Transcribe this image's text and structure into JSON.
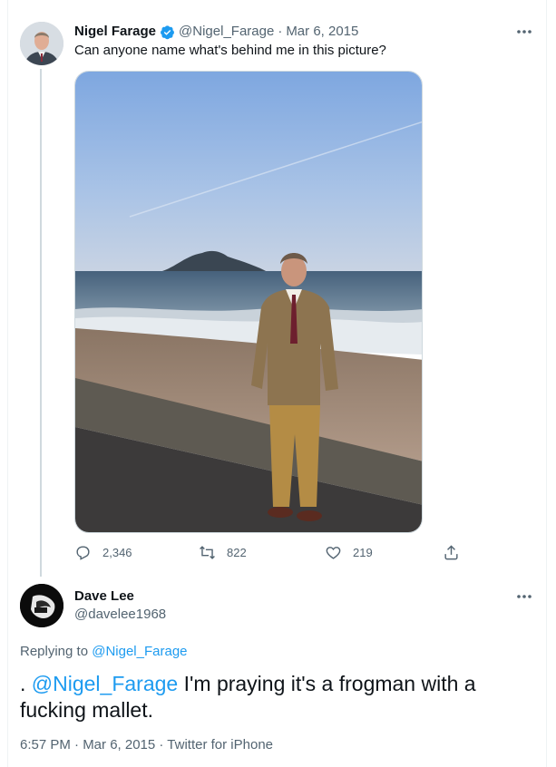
{
  "tweet": {
    "author_name": "Nigel Farage",
    "handle": "@Nigel_Farage",
    "separator": "·",
    "date": "Mar 6, 2015",
    "text": "Can anyone name what's behind me in this picture?",
    "stats": {
      "replies": "2,346",
      "retweets": "822",
      "likes": "219"
    }
  },
  "reply": {
    "author_name": "Dave Lee",
    "handle": "@davelee1968",
    "replying_prefix": "Replying to",
    "replying_to": "@Nigel_Farage",
    "text_prefix": ".",
    "mention": "@Nigel_Farage",
    "text_body": "I'm praying it's a frogman with a fucking mallet.",
    "time": "6:57 PM · Mar 6, 2015 · Twitter for iPhone"
  },
  "icons": [
    "verified-badge-icon",
    "more-icon",
    "reply-icon",
    "retweet-icon",
    "like-icon",
    "share-icon"
  ],
  "colors": {
    "link": "#1d9bf0",
    "secondary_text": "#536471",
    "text": "#0f1419",
    "verified": "#1d9bf0"
  }
}
